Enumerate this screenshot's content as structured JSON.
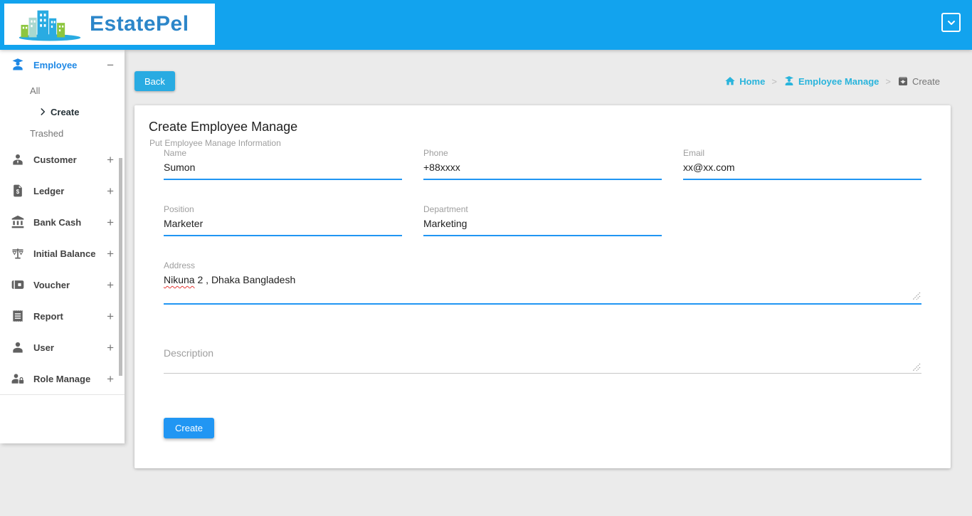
{
  "brand": {
    "name": "EstatePel"
  },
  "header": {
    "dropdown_icon": "chevron-down"
  },
  "sidebar": {
    "sections": [
      {
        "label": "Employee",
        "icon": "employee-icon",
        "toggle": "−",
        "state": "expanded",
        "active": true,
        "children": [
          {
            "label": "All",
            "active": false
          },
          {
            "label": "Create",
            "active": true,
            "icon": "chevron-right"
          },
          {
            "label": "Trashed",
            "active": false
          }
        ]
      },
      {
        "label": "Customer",
        "icon": "customer-icon",
        "toggle": "+"
      },
      {
        "label": "Ledger",
        "icon": "ledger-icon",
        "toggle": "+"
      },
      {
        "label": "Bank Cash",
        "icon": "bank-icon",
        "toggle": "+"
      },
      {
        "label": "Initial Balance",
        "icon": "balance-scale-icon",
        "toggle": "+"
      },
      {
        "label": "Voucher",
        "icon": "voucher-icon",
        "toggle": "+"
      },
      {
        "label": "Report",
        "icon": "report-icon",
        "toggle": "+"
      },
      {
        "label": "User",
        "icon": "user-icon",
        "toggle": "+"
      },
      {
        "label": "Role Manage",
        "icon": "role-manage-icon",
        "toggle": "+"
      }
    ]
  },
  "toolbar": {
    "back_label": "Back"
  },
  "breadcrumb": {
    "separator": ">",
    "items": [
      {
        "label": "Home",
        "icon": "home-icon",
        "type": "link"
      },
      {
        "label": "Employee Manage",
        "icon": "employee-icon",
        "type": "link"
      },
      {
        "label": "Create",
        "icon": "archive-icon",
        "type": "current"
      }
    ]
  },
  "form": {
    "title": "Create Employee Manage",
    "subtitle": "Put Employee Manage Information",
    "fields": {
      "name": {
        "label": "Name",
        "value": "Sumon"
      },
      "phone": {
        "label": "Phone",
        "value": "+88xxxx"
      },
      "email": {
        "label": "Email",
        "value": "xx@xx.com"
      },
      "position": {
        "label": "Position",
        "value": "Marketer"
      },
      "department": {
        "label": "Department",
        "value": "Marketing"
      },
      "address": {
        "label": "Address",
        "value": "Nikuna 2 , Dhaka Bangladesh",
        "misspelled_segment": "Nikuna",
        "rest_segment": " 2 , Dhaka Bangladesh"
      },
      "description": {
        "placeholder": "Description",
        "value": ""
      }
    },
    "submit_label": "Create"
  },
  "colors": {
    "header_blue": "#12A3EE",
    "back_button_blue": "#29ABE2",
    "breadcrumb_link_cyan": "#29B4DC",
    "sidebar_active_blue": "#1E88E5",
    "field_underline_blue": "#2196F3",
    "create_button_blue": "#2196F3",
    "logo_text_blue": "#2C86C9",
    "logo_green": "#8DC63F",
    "spellcheck_red": "#E53935",
    "page_background": "#EBEBEB"
  }
}
